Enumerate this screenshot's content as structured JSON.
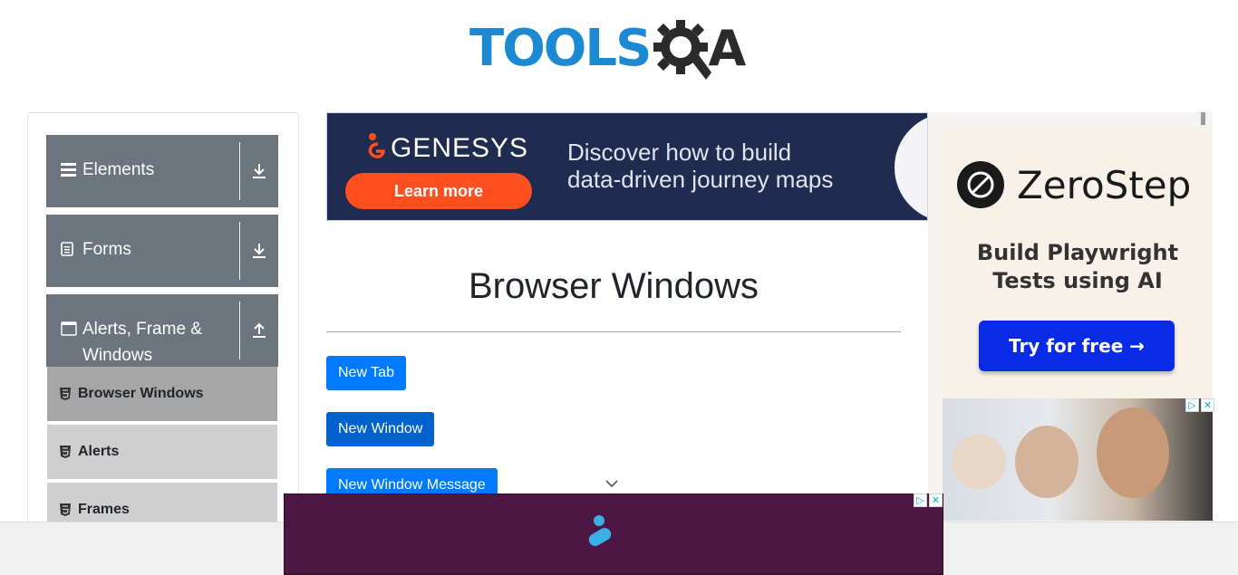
{
  "header": {
    "logo_text": "TOOLS",
    "logo_text_2": "A"
  },
  "sidebar": {
    "groups": [
      {
        "label": "Elements",
        "icon": "hamburger-icon",
        "toggle_icon": "download-arrow-icon"
      },
      {
        "label": "Forms",
        "icon": "document-icon",
        "toggle_icon": "download-arrow-icon"
      },
      {
        "label": "Alerts, Frame & Windows",
        "icon": "window-icon",
        "toggle_icon": "upload-arrow-icon"
      }
    ],
    "items": [
      {
        "label": "Browser Windows",
        "active": true
      },
      {
        "label": "Alerts",
        "active": false
      },
      {
        "label": "Frames",
        "active": false
      }
    ]
  },
  "ad_banner": {
    "brand": "GENESYS",
    "cta": "Learn more",
    "message_line1": "Discover how to build",
    "message_line2": "data-driven journey maps"
  },
  "main": {
    "title": "Browser Windows",
    "buttons": [
      {
        "label": "New Tab"
      },
      {
        "label": "New Window"
      },
      {
        "label": "New Window Message"
      }
    ]
  },
  "right_ad": {
    "brand": "ZeroStep",
    "headline_line1": "Build Playwright",
    "headline_line2": "Tests using AI",
    "cta": "Try for free →"
  },
  "colors": {
    "primary": "#007bff",
    "sidebar_header": "#6c757d",
    "sidebar_item": "#cfcfcf",
    "sidebar_item_active": "#a6a6a6",
    "logo_blue": "#1b8ad3"
  }
}
